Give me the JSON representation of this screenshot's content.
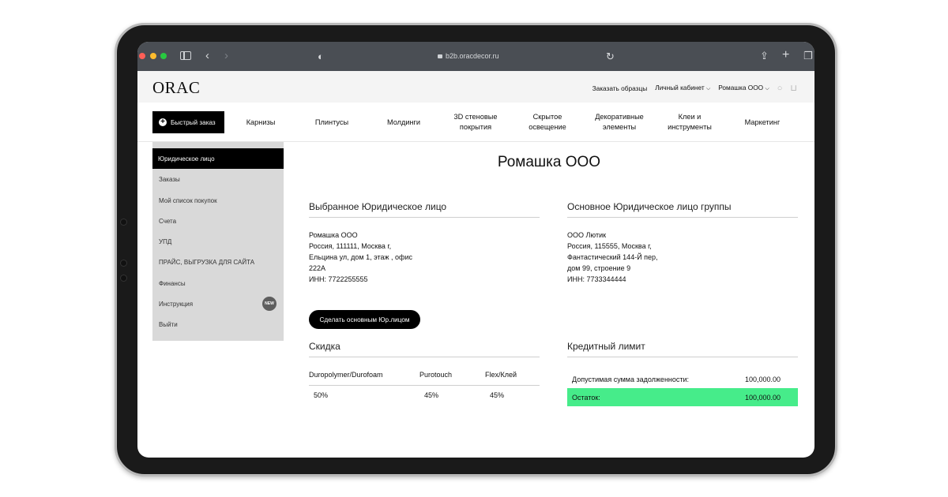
{
  "browser": {
    "url": "b2b.oracdecor.ru"
  },
  "header": {
    "logo": "ORAC",
    "links": [
      "Заказать образцы",
      "Личный кабинет",
      "Ромашка ООО"
    ]
  },
  "nav": {
    "quick_order": "Быстрый заказ",
    "items": [
      "Карнизы",
      "Плинтусы",
      "Молдинги",
      "3D стеновые покрытия",
      "Скрытое освещение",
      "Декоративные элементы",
      "Клеи и инструменты",
      "Маркетинг"
    ]
  },
  "sidebar": {
    "items": [
      "Юридическое лицо",
      "Заказы",
      "Мой список покупок",
      "Счета",
      "УПД",
      "ПРАЙС, ВЫГРУЗКА ДЛЯ САЙТА",
      "Финансы",
      "Инструкция",
      "Выйти"
    ],
    "badge": "NEW"
  },
  "main": {
    "title": "Ромашка ООО",
    "selected": {
      "heading": "Выбранное Юридическое лицо",
      "lines": [
        "Ромашка ООО",
        "Россия, 111111, Москва г,",
        "Ельцина ул, дом 1, этаж , офис",
        "222А",
        "ИНН: 7722255555"
      ]
    },
    "group": {
      "heading": "Основное Юридическое лицо группы",
      "lines": [
        "ООО Лютик",
        "Россия, 115555, Москва г,",
        "Фантастический 144-Й пер,",
        "дом 99, строение 9",
        "ИНН: 7733344444"
      ]
    },
    "make_main_button": "Сделать основным Юр.лицом",
    "discount": {
      "heading": "Скидка",
      "columns": [
        "Duropolymer/Durofoam",
        "Purotouch",
        "Flex/Клей"
      ],
      "values": [
        "50%",
        "45%",
        "45%"
      ]
    },
    "credit": {
      "heading": "Кредитный лимит",
      "allowed_label": "Допустимая сумма задолженности:",
      "allowed_value": "100,000.00",
      "remaining_label": "Остаток:",
      "remaining_value": "100,000.00"
    }
  },
  "colors": {
    "accent_green": "#46ec8a",
    "sidebar_bg": "#d9d9d9"
  }
}
